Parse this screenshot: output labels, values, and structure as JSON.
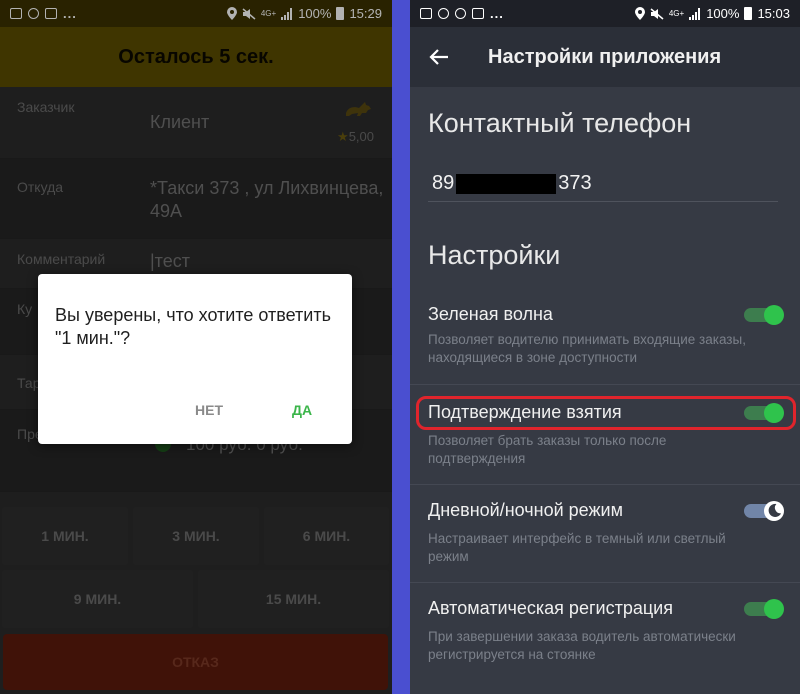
{
  "left": {
    "status": {
      "time": "15:29",
      "battery": "100%",
      "net": "4G+"
    },
    "timer": "Осталось 5 сек.",
    "rows": [
      {
        "label": "Заказчик",
        "value": "Клиент"
      },
      {
        "label": "Откуда",
        "value": "*Такси 373 , ул Лихвинцева, 49А"
      },
      {
        "label": "Комментарий",
        "value": "|тест"
      },
      {
        "label": "Ку",
        "value": ""
      },
      {
        "label": "Тар",
        "value": ""
      },
      {
        "label": "Пре стоимость",
        "value": "100 руб. 0 руб."
      }
    ],
    "rating": "5,00",
    "minutes": [
      "1 МИН.",
      "3 МИН.",
      "6 МИН.",
      "9 МИН.",
      "15 МИН."
    ],
    "refuse": "ОТКАЗ",
    "dialog": {
      "message": "Вы уверены, что хотите ответить \"1 мин.\"?",
      "no": "НЕТ",
      "yes": "ДА"
    }
  },
  "right": {
    "status": {
      "time": "15:03",
      "battery": "100%",
      "net": "4G+"
    },
    "title": "Настройки приложения",
    "contact_title": "Контактный телефон",
    "phone_prefix": "89",
    "phone_suffix": "373",
    "settings_title": "Настройки",
    "settings": [
      {
        "title": "Зеленая волна",
        "desc": "Позволяет водителю принимать входящие заказы, находящиеся в зоне доступности"
      },
      {
        "title": "Подтверждение взятия",
        "desc": "Позволяет брать заказы только после подтверждения"
      },
      {
        "title": "Дневной/ночной режим",
        "desc": "Настраивает интерфейс в темный или светлый режим"
      },
      {
        "title": "Автоматическая регистрация",
        "desc": "При завершении заказа водитель автоматически регистрируется на стоянке"
      }
    ],
    "colors": {
      "toggle_on": "#2fc34c",
      "highlight": "#e0242c",
      "background": "#363a44"
    }
  }
}
